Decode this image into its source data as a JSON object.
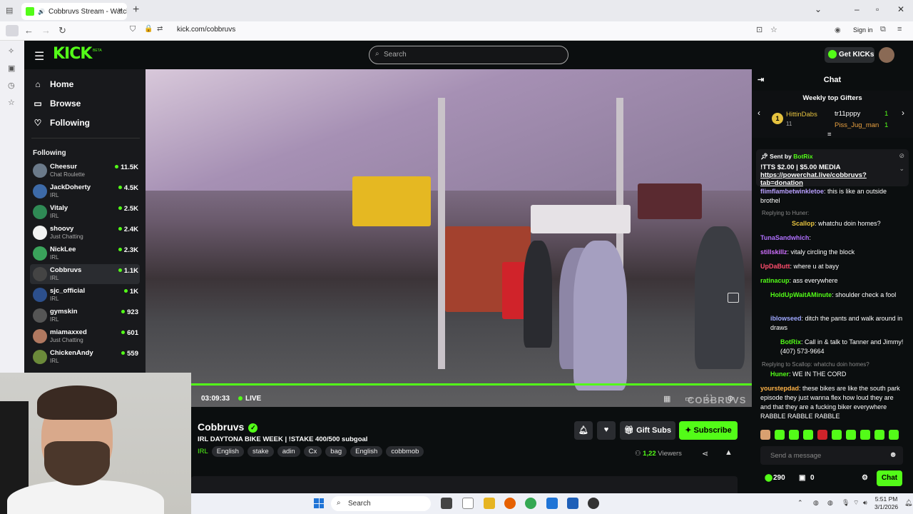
{
  "browser": {
    "tab_title": "Cobbruvs Stream - Watch L",
    "url": "kick.com/cobbruvs",
    "sign_in": "Sign in"
  },
  "header": {
    "logo": "KICK",
    "beta": "BETA",
    "search_placeholder": "Search",
    "get_kicks": "Get KICKs"
  },
  "sidebar": {
    "nav": [
      {
        "label": "Home",
        "icon": "home-icon"
      },
      {
        "label": "Browse",
        "icon": "browse-icon"
      },
      {
        "label": "Following",
        "icon": "heart-icon"
      }
    ],
    "following_header": "Following",
    "channels": [
      {
        "name": "Cheesur",
        "category": "Chat Roulette",
        "viewers": "11.5K",
        "avatar_color": "#6b7a8a"
      },
      {
        "name": "JackDoherty",
        "category": "IRL",
        "viewers": "4.5K",
        "avatar_color": "#3d6aa8"
      },
      {
        "name": "Vitaly",
        "category": "IRL",
        "viewers": "2.5K",
        "avatar_color": "#2f8a55"
      },
      {
        "name": "shoovy",
        "category": "Just Chatting",
        "viewers": "2.4K",
        "avatar_color": "#f2f2f2"
      },
      {
        "name": "NickLee",
        "category": "IRL",
        "viewers": "2.3K",
        "avatar_color": "#3aa35b"
      },
      {
        "name": "Cobbruvs",
        "category": "IRL",
        "viewers": "1.1K",
        "avatar_color": "#444444"
      },
      {
        "name": "sjc_official",
        "category": "IRL",
        "viewers": "1K",
        "avatar_color": "#2c4f8c"
      },
      {
        "name": "gymskin",
        "category": "IRL",
        "viewers": "923",
        "avatar_color": "#555555"
      },
      {
        "name": "miamaxxed",
        "category": "Just Chatting",
        "viewers": "601",
        "avatar_color": "#b07860"
      },
      {
        "name": "ChickenAndy",
        "category": "IRL",
        "viewers": "559",
        "avatar_color": "#6b8a3a"
      }
    ]
  },
  "player": {
    "time": "03:09:33",
    "live": "LIVE",
    "watermark": "COBBRUVS"
  },
  "stream": {
    "name": "Cobbruvs",
    "title": "IRL DAYTONA BIKE WEEK  | !STAKE 400/500 subgoal",
    "category": "IRL",
    "tags": [
      "English",
      "stake",
      "adin",
      "Cx",
      "bag",
      "English",
      "cobbmob"
    ],
    "gift_subs": "Gift Subs",
    "subscribe": "Subscribe",
    "viewers_count": "1,22",
    "viewers_label": "Viewers"
  },
  "chat": {
    "title": "Chat",
    "gifters_title": "Weekly top Gifters",
    "gifters": [
      {
        "name": "HittinDabs",
        "count": "11",
        "color": "#e5c23f"
      },
      {
        "name": "tr11pppy",
        "count": "1",
        "color": "#ffffff"
      },
      {
        "name": "Piss_Jug_man",
        "count": "1",
        "color": "#e8a040"
      }
    ],
    "pinned": {
      "sent_by": "Sent by",
      "sender": "BotRix",
      "text": "!TTS $2.00 | $5.00 MEDIA",
      "link": "https://powerchat.live/cobbruvs?tab=donation"
    },
    "messages": [
      {
        "user": "flimflambetwinkletoe",
        "color": "#b9a0ff",
        "text": ": this is like an outside brothel"
      },
      {
        "reply": "Replying to Huner:",
        "user": "Scallop",
        "color": "#e5c23f",
        "text": ": whatchu doin homes?"
      },
      {
        "user": "TunaSandwhich",
        "color": "#b070ff",
        "text": ":"
      },
      {
        "user": "stillskillz",
        "color": "#d070ff",
        "text": ": vitaly circling the block"
      },
      {
        "user": "UpDaButt",
        "color": "#ff4d6d",
        "text": ": where u at bayy"
      },
      {
        "user": "ratinacup",
        "color": "#53fc18",
        "text": ": ass everywhere"
      },
      {
        "user": "HoldUpWaitAMinute",
        "color": "#53fc18",
        "text": ": shoulder check a fool"
      },
      {
        "user": "iblowseed",
        "color": "#9fa8ff",
        "text": ": ditch the pants and walk around in draws"
      },
      {
        "user": "BotRix",
        "color": "#53fc18",
        "text": ": Call in & talk to Tanner and Jimmy! (407) 573-9664"
      },
      {
        "reply": "Replying to Scallop: whatchu doin homes?",
        "user": "Huner",
        "color": "#53fc18",
        "text": ": WE IN THE CORD"
      },
      {
        "user": "yourstepdad",
        "color": "#ffb347",
        "text": ": these bikes are like the south park episode they just wanna flex how loud they are and that they are a fucking biker everywhere RABBLE RABBLE RABBLE"
      }
    ],
    "input_placeholder": "Send a message",
    "points": "290",
    "gifts": "0",
    "send_button": "Chat"
  },
  "taskbar": {
    "search": "Search",
    "time": "5:51 PM",
    "date": "3/1/2026"
  },
  "colors": {
    "accent": "#53fc18",
    "bg": "#0b0e0f",
    "panel": "#18191c"
  }
}
